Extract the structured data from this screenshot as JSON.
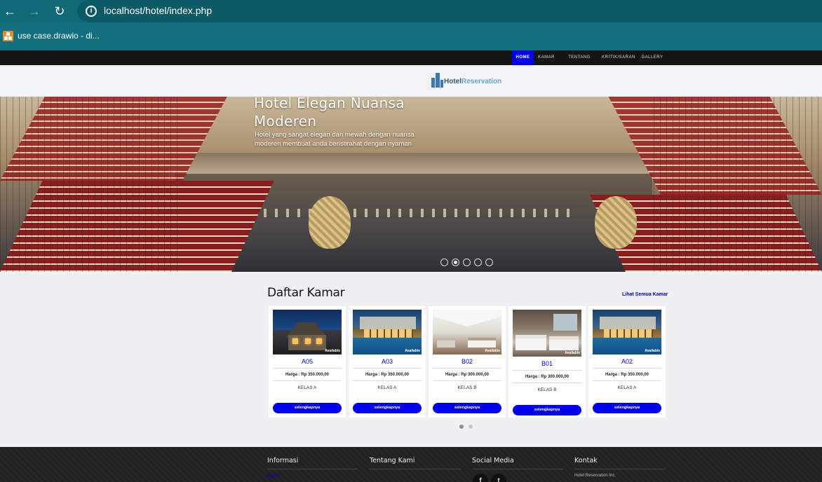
{
  "browser": {
    "url": "localhost/hotel/index.php",
    "back_icon": "arrow-left-icon",
    "forward_icon": "arrow-right-icon",
    "reload_icon": "reload-icon",
    "bookmark": {
      "label": "use case.drawio - di...",
      "icon": "drawio-icon"
    }
  },
  "nav": {
    "items": [
      {
        "label": "HOME"
      },
      {
        "label": "KAMAR"
      },
      {
        "label": "TENTANG KAMI"
      },
      {
        "label": "KRITIK/SARAN"
      },
      {
        "label": "GALLERY"
      }
    ]
  },
  "logo": {
    "part1": "Hotel",
    "part2": "Reservation",
    "colors": {
      "part1": "#3a5a7a",
      "part2": "#6aa3d0"
    }
  },
  "hero": {
    "title": "Hotel Elegan Nuansa Moderen",
    "subtitle": "Hotel yang sangat elegan dan mewah dengan nuansa moderen membuat anda beristirahat dengan nyaman",
    "slides": 5,
    "active_slide": 2
  },
  "rooms": {
    "title": "Daftar Kamar",
    "see_all": "Lihat Semua Kamar",
    "items": [
      {
        "code": "A05",
        "status": "Available",
        "price": "Harga : Rp 350.000,00",
        "kelas": "KELAS A",
        "button": "selengkapnya",
        "image": "house-photo"
      },
      {
        "code": "A03",
        "status": "Available",
        "price": "Harga : Rp 350.000,00",
        "kelas": "KELAS A",
        "button": "selengkapnya",
        "image": "pool-villa-photo"
      },
      {
        "code": "B02",
        "status": "Available",
        "price": "Harga : Rp 300.000,00",
        "kelas": "KELAS B",
        "button": "selengkapnya",
        "image": "suite-photo"
      },
      {
        "code": "B01",
        "status": "Available",
        "price": "Harga : Rp 300.000,00",
        "kelas": "KELAS B",
        "button": "selengkapnya",
        "image": "bedroom-photo"
      },
      {
        "code": "A02",
        "status": "Available",
        "price": "Harga : Rp 350.000,00",
        "kelas": "KELAS A",
        "button": "selengkapnya",
        "image": "pool-villa-photo"
      }
    ],
    "pages": 2,
    "active_page": 1
  },
  "footer": {
    "columns": [
      {
        "title": "Informasi"
      },
      {
        "title": "Tentang Kami"
      },
      {
        "title": "Social Media"
      },
      {
        "title": "Kontak"
      }
    ],
    "info_link": "Home",
    "contact_line": "Hotel Reservation Inc.",
    "social": [
      {
        "icon": "facebook-icon",
        "glyph": "f"
      },
      {
        "icon": "twitter-icon",
        "glyph": "t"
      }
    ]
  },
  "colors": {
    "accent": "#0000ee",
    "browser_bar": "#0f6a78",
    "nav_bg": "#141414"
  }
}
